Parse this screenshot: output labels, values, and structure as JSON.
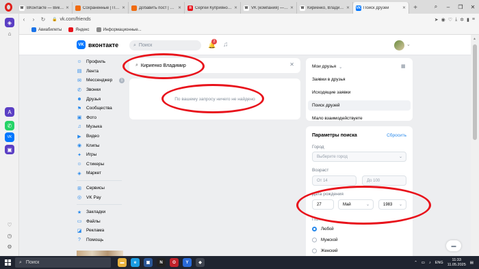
{
  "browser": {
    "tabs": [
      {
        "title": "ВКонтакте — Википедия",
        "fav": "W",
        "favColor": "#ffffff",
        "favText": "#000000",
        "active": false
      },
      {
        "title": "Сохраненные | Пикабу",
        "fav": "",
        "favColor": "#f06b0f",
        "favText": "#ffffff",
        "active": false
      },
      {
        "title": "Добавить пост | Пикабу",
        "fav": "",
        "favColor": "#f06b0f",
        "favText": "#ffffff",
        "active": false
      },
      {
        "title": "Сергей Куприянов дире",
        "fav": "Я",
        "favColor": "#e8121b",
        "favText": "#ffffff",
        "active": false
      },
      {
        "title": "VK (компания) — Википе",
        "fav": "W",
        "favColor": "#ffffff",
        "favText": "#000000",
        "active": false
      },
      {
        "title": "Кириенко, Владимир Се",
        "fav": "W",
        "favColor": "#ffffff",
        "favText": "#000000",
        "active": false
      },
      {
        "title": "Поиск друзей",
        "fav": "VK",
        "favColor": "#0077ff",
        "favText": "#ffffff",
        "active": true
      }
    ],
    "url": "vk.com/friends",
    "bookmarks": [
      {
        "label": "Авиабилеты",
        "color": "#1a73e8"
      },
      {
        "label": "Яндекс",
        "color": "#e8121b"
      },
      {
        "label": "Информационные...",
        "color": "#888888"
      }
    ]
  },
  "vk": {
    "logo_mark": "VK",
    "logo": "вконтакте",
    "header_search_placeholder": "Поиск",
    "notifications_count": "2",
    "menu": [
      {
        "label": "Профиль",
        "icon": "user-icon",
        "glyph": "☺"
      },
      {
        "label": "Лента",
        "icon": "news-icon",
        "glyph": "▤"
      },
      {
        "label": "Мессенджер",
        "icon": "message-icon",
        "glyph": "✉",
        "count": "1"
      },
      {
        "label": "Звонки",
        "icon": "phone-icon",
        "glyph": "✆"
      },
      {
        "label": "Друзья",
        "icon": "friends-icon",
        "glyph": "☻"
      },
      {
        "label": "Сообщества",
        "icon": "groups-icon",
        "glyph": "⚑"
      },
      {
        "label": "Фото",
        "icon": "photo-icon",
        "glyph": "▣"
      },
      {
        "label": "Музыка",
        "icon": "music-icon",
        "glyph": "♫"
      },
      {
        "label": "Видео",
        "icon": "video-icon",
        "glyph": "▶"
      },
      {
        "label": "Клипы",
        "icon": "clips-icon",
        "glyph": "◉"
      },
      {
        "label": "Игры",
        "icon": "games-icon",
        "glyph": "✦"
      },
      {
        "label": "Стикеры",
        "icon": "stickers-icon",
        "glyph": "☺"
      },
      {
        "label": "Маркет",
        "icon": "market-icon",
        "glyph": "◈"
      }
    ],
    "menu2": [
      {
        "label": "Сервисы",
        "icon": "services-icon",
        "glyph": "⊞"
      },
      {
        "label": "VK Pay",
        "icon": "vkpay-icon",
        "glyph": "◎"
      }
    ],
    "menu3": [
      {
        "label": "Закладки",
        "icon": "bookmark-icon",
        "glyph": "★"
      },
      {
        "label": "Файлы",
        "icon": "files-icon",
        "glyph": "▭"
      },
      {
        "label": "Реклама",
        "icon": "ads-icon",
        "glyph": "◪"
      },
      {
        "label": "Помощь",
        "icon": "help-icon",
        "glyph": "?"
      }
    ],
    "search_query": "Кириенко Владимир",
    "no_results": "По вашему запросу ничего не найдено",
    "friends_menu": [
      {
        "label": "Мои друзья",
        "chevron": true
      },
      {
        "label": "Заявки в друзья"
      },
      {
        "label": "Исходящие заявки"
      },
      {
        "label": "Поиск друзей",
        "active": true
      },
      {
        "label": "Мало взаимодействуете"
      }
    ],
    "params": {
      "title": "Параметры поиска",
      "reset": "Сбросить",
      "city_label": "Город",
      "city_placeholder": "Выберите город",
      "age_label": "Возраст",
      "age_from": "От 14",
      "age_to": "До 100",
      "birth_label": "Дата рождения",
      "day": "27",
      "month": "Май",
      "year": "1983",
      "gender_label": "Пол",
      "gender_options": [
        "Любой",
        "Мужской",
        "Женский"
      ],
      "gender_selected": 0
    }
  },
  "taskbar": {
    "search": "Поиск",
    "lang": "ENG",
    "time": "11:33",
    "date": "11.05.2025"
  },
  "colors": {
    "accent": "#2688eb",
    "annotation": "#e8121b",
    "vk_blue": "#0077ff"
  }
}
